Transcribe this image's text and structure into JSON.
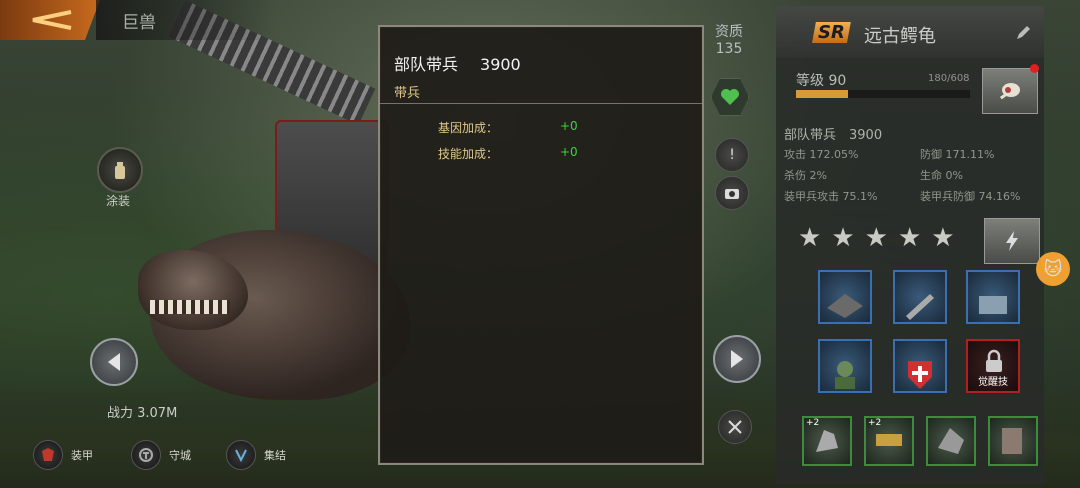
{
  "header": {
    "title": "巨兽"
  },
  "left": {
    "paint_label": "涂装",
    "power": "战力 3.07M",
    "bottom_buttons": [
      {
        "label": "装甲",
        "icon": "armor-icon"
      },
      {
        "label": "守城",
        "icon": "defend-icon"
      },
      {
        "label": "集结",
        "icon": "rally-icon"
      }
    ]
  },
  "popup": {
    "title": "部队带兵",
    "title_value": "3900",
    "subtitle": "带兵",
    "rows": [
      {
        "label": "基因加成：",
        "value": "+0"
      },
      {
        "label": "技能加成：",
        "value": "+0"
      }
    ]
  },
  "middle": {
    "quality_label": "资质",
    "quality_value": "135"
  },
  "panel": {
    "rarity": "SR",
    "name": "远古鳄龟",
    "level_label": "等级 90",
    "exp_text": "180/608",
    "exp_fraction": 0.296,
    "troops": "部队带兵　3900",
    "stats": {
      "attack": "攻击 172.05%",
      "defense": "防御 171.11%",
      "kill": "杀伤 2%",
      "life": "生命 0%",
      "armor_attack": "装甲兵攻击 75.1%",
      "armor_defense": "装甲兵防御 74.16%"
    },
    "stars": 5,
    "skills_row2": [
      {
        "label": ""
      },
      {
        "label": ""
      },
      {
        "label": "觉醒技"
      }
    ],
    "equip_plus": [
      "+2",
      "+2"
    ]
  },
  "colors": {
    "accent_orange": "#c96b1e",
    "green_value": "#3fd23f",
    "gold_label": "#e2c88a"
  }
}
